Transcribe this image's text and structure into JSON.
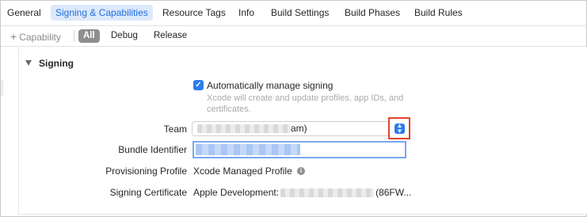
{
  "tabs": [
    {
      "label": "General"
    },
    {
      "label": "Signing & Capabilities",
      "active": true
    },
    {
      "label": "Resource Tags"
    },
    {
      "label": "Info"
    },
    {
      "label": "Build Settings"
    },
    {
      "label": "Build Phases"
    },
    {
      "label": "Build Rules"
    }
  ],
  "filter": {
    "capability_label": "Capability",
    "configs": [
      "All",
      "Debug",
      "Release"
    ],
    "selected": "All"
  },
  "signing": {
    "section_title": "Signing",
    "auto_manage": {
      "label": "Automatically manage signing",
      "checked": true,
      "hint": "Xcode will create and update profiles, app IDs, and certificates."
    },
    "team": {
      "label": "Team",
      "value_suffix": "am)"
    },
    "bundle_identifier": {
      "label": "Bundle Identifier"
    },
    "provisioning_profile": {
      "label": "Provisioning Profile",
      "value": "Xcode Managed Profile"
    },
    "signing_certificate": {
      "label": "Signing Certificate",
      "value_prefix": "Apple Development:",
      "value_suffix": "(86FW..."
    }
  },
  "icons": {
    "plus": "plus-icon",
    "disclosure": "disclosure-triangle-icon",
    "checkbox": "checkmark-icon",
    "stepper": "popup-stepper-icon",
    "info": "info-icon"
  },
  "colors": {
    "accent": "#2a7cf0",
    "tab_active_bg": "#dce9fb",
    "highlight_box": "#e0442c"
  }
}
